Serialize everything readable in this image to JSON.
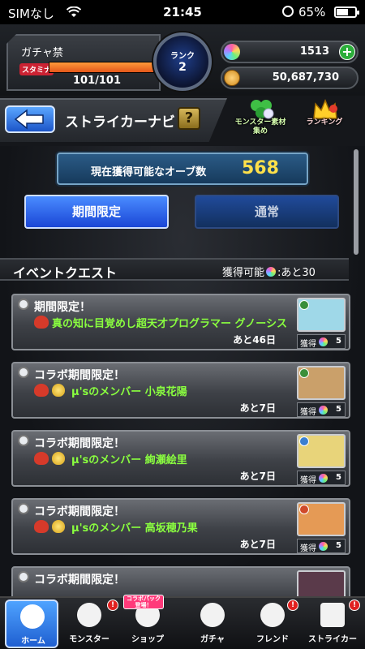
{
  "status_bar": {
    "carrier": "SIMなし",
    "time": "21:45",
    "battery": "65%"
  },
  "header": {
    "gacha_ban": "ガチャ禁",
    "stamina_label": "スタミナ",
    "stamina_value": "101/101",
    "stamina_fraction": 1.0,
    "rank_label": "ランク",
    "rank_value": "2",
    "orbs": "1513",
    "gold": "50,687,730"
  },
  "nav": {
    "title": "ストライカーナビ",
    "help": "?",
    "monster_tile": "モンスター素材集め",
    "ranking_tile": "ランキング"
  },
  "main": {
    "orb_label": "現在獲得可能なオーブ数",
    "orb_count": "568",
    "tab_limited": "期間限定",
    "tab_normal": "通常",
    "section_title": "イベントクエスト",
    "section_avail_prefix": "獲得可能",
    "section_avail_suffix": ":あと30"
  },
  "quests": [
    {
      "title": "期間限定！",
      "name": "真の知に目覚めし超天才プログラマー グノーシス",
      "remain": "あと46日",
      "reward_label": "獲得",
      "reward": "5",
      "thumb_color": "#9fd8e8"
    },
    {
      "title": "コラボ期間限定！",
      "name": "μ'sのメンバー 小泉花陽",
      "remain": "あと7日",
      "reward_label": "獲得",
      "reward": "5",
      "thumb_color": "#caa06a"
    },
    {
      "title": "コラボ期間限定！",
      "name": "μ'sのメンバー 絢瀬絵里",
      "remain": "あと7日",
      "reward_label": "獲得",
      "reward": "5",
      "thumb_color": "#e8d47a"
    },
    {
      "title": "コラボ期間限定！",
      "name": "μ'sのメンバー 高坂穂乃果",
      "remain": "あと7日",
      "reward_label": "獲得",
      "reward": "5",
      "thumb_color": "#e59a55"
    },
    {
      "title": "コラボ期間限定！",
      "name": "",
      "remain": "",
      "reward_label": "",
      "reward": "",
      "thumb_color": "#5a3a4a"
    }
  ],
  "tabbar": {
    "home": "ホーム",
    "monster": "モンスター",
    "shop": "ショップ",
    "shop_promo": "コラボパック登場！",
    "gacha": "ガチャ",
    "friend": "フレンド",
    "striker": "ストライカー",
    "badge": "!"
  },
  "colors": {
    "accent_blue": "#2a6cf0",
    "quest_name_green": "#8aff3f",
    "orb_count_yellow": "#ffe04a"
  }
}
